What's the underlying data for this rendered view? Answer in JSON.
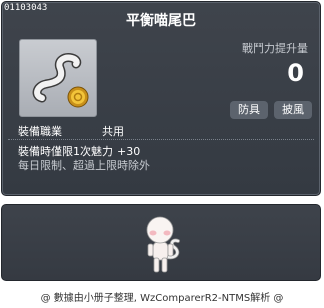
{
  "item": {
    "id": "01103043",
    "name": "平衡喵尾巴",
    "stat_label": "戰鬥力提升量",
    "stat_value": "0",
    "tags": [
      "防具",
      "披風"
    ],
    "job_label": "裝備職業",
    "job_value": "共用",
    "effect_text": "裝備時僅限1次魅力",
    "effect_bonus": "+30",
    "limit_text": "每日限制、超過上限時除外"
  },
  "icons": {
    "item_icon": "white-cat-tail-with-gold-coin-icon",
    "preview": "character-wearing-cat-tail-preview"
  },
  "footer": {
    "credit": "@ 數據由小册子整理, WzComparerR2-NTMS解析 @"
  },
  "colors": {
    "panel": "#3a3f47",
    "tag_bg": "#5c636d",
    "coin": "#e6b422"
  }
}
